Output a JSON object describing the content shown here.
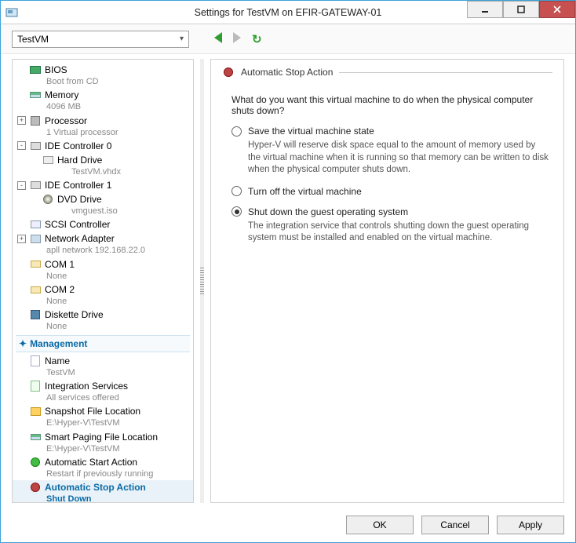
{
  "titlebar": {
    "text": "Settings for TestVM on EFIR-GATEWAY-01"
  },
  "toolbar": {
    "vm_select_value": "TestVM"
  },
  "tree": {
    "management_header": "Management",
    "items": [
      {
        "label": "BIOS",
        "sub": "Boot from CD",
        "expander": "",
        "icon": "chip"
      },
      {
        "label": "Memory",
        "sub": "4096 MB",
        "expander": "",
        "icon": "mem"
      },
      {
        "label": "Processor",
        "sub": "1 Virtual processor",
        "expander": "+",
        "icon": "cpu"
      },
      {
        "label": "IDE Controller 0",
        "sub": "",
        "expander": "-",
        "icon": "hdd"
      },
      {
        "label": "Hard Drive",
        "sub": "TestVM.vhdx",
        "expander": "",
        "icon": "drive",
        "child": true
      },
      {
        "label": "IDE Controller 1",
        "sub": "",
        "expander": "-",
        "icon": "hdd"
      },
      {
        "label": "DVD Drive",
        "sub": "vmguest.iso",
        "expander": "",
        "icon": "dvd",
        "child": true
      },
      {
        "label": "SCSI Controller",
        "sub": "",
        "expander": "",
        "icon": "scsi"
      },
      {
        "label": "Network Adapter",
        "sub": "apll network 192.168.22.0",
        "expander": "+",
        "icon": "net"
      },
      {
        "label": "COM 1",
        "sub": "None",
        "expander": "",
        "icon": "com"
      },
      {
        "label": "COM 2",
        "sub": "None",
        "expander": "",
        "icon": "com"
      },
      {
        "label": "Diskette Drive",
        "sub": "None",
        "expander": "",
        "icon": "disk"
      }
    ],
    "mgmt": [
      {
        "label": "Name",
        "sub": "TestVM",
        "icon": "name"
      },
      {
        "label": "Integration Services",
        "sub": "All services offered",
        "icon": "intg"
      },
      {
        "label": "Snapshot File Location",
        "sub": "E:\\Hyper-V\\TestVM",
        "icon": "snap"
      },
      {
        "label": "Smart Paging File Location",
        "sub": "E:\\Hyper-V\\TestVM",
        "icon": "page"
      },
      {
        "label": "Automatic Start Action",
        "sub": "Restart if previously running",
        "icon": "start"
      },
      {
        "label": "Automatic Stop Action",
        "sub": "Shut Down",
        "icon": "stop",
        "selected": true
      }
    ]
  },
  "right": {
    "title": "Automatic Stop Action",
    "question": "What do you want this virtual machine to do when the physical computer shuts down?",
    "opt1": {
      "label": "Save the virtual machine state",
      "desc": "Hyper-V will reserve disk space equal to the amount of memory used by the virtual machine when it is running so that memory can be written to disk when the physical computer shuts down."
    },
    "opt2": {
      "label": "Turn off the virtual machine",
      "desc": ""
    },
    "opt3": {
      "label": "Shut down the guest operating system",
      "desc": "The integration service that controls shutting down the guest operating system must be installed and enabled on the virtual machine."
    }
  },
  "footer": {
    "ok": "OK",
    "cancel": "Cancel",
    "apply": "Apply"
  }
}
